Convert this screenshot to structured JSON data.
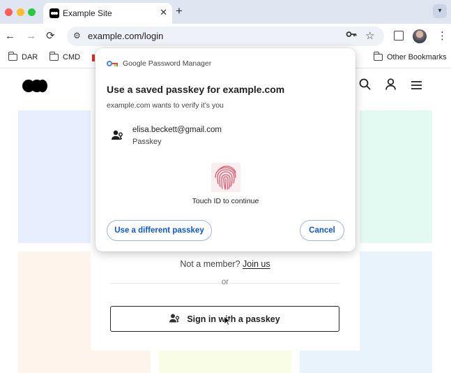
{
  "browser": {
    "tab_title": "Example Site",
    "url": "example.com/login",
    "bookmarks": [
      "DAR",
      "CMD"
    ],
    "other_bookmarks": "Other Bookmarks",
    "new_tab_symbol": "+",
    "close_symbol": "✕"
  },
  "page": {
    "member_prompt": "Not a member?",
    "join_link": "Join us",
    "divider_text": "or",
    "passkey_button": "Sign in with a passkey"
  },
  "dialog": {
    "manager_name": "Google Password Manager",
    "title": "Use a saved passkey for example.com",
    "subtitle": "example.com wants to verify it’s you",
    "account_email": "elisa.beckett@gmail.com",
    "account_type": "Passkey",
    "touch_text": "Touch ID to continue",
    "different_button": "Use a different passkey",
    "cancel_button": "Cancel"
  },
  "colors": {
    "accent_blue": "#0b57d0",
    "tabbar_bg": "#dfe6f2",
    "fingerprint": "#e0566b"
  },
  "icons": [
    "back-arrow-icon",
    "forward-arrow-icon",
    "reload-icon",
    "site-settings-icon",
    "key-icon",
    "star-icon",
    "extensions-icon",
    "profile-avatar-icon",
    "kebab-menu-icon",
    "folder-icon",
    "search-icon",
    "user-icon",
    "hamburger-menu-icon",
    "passkey-person-icon",
    "fingerprint-icon",
    "mouse-cursor-icon"
  ]
}
